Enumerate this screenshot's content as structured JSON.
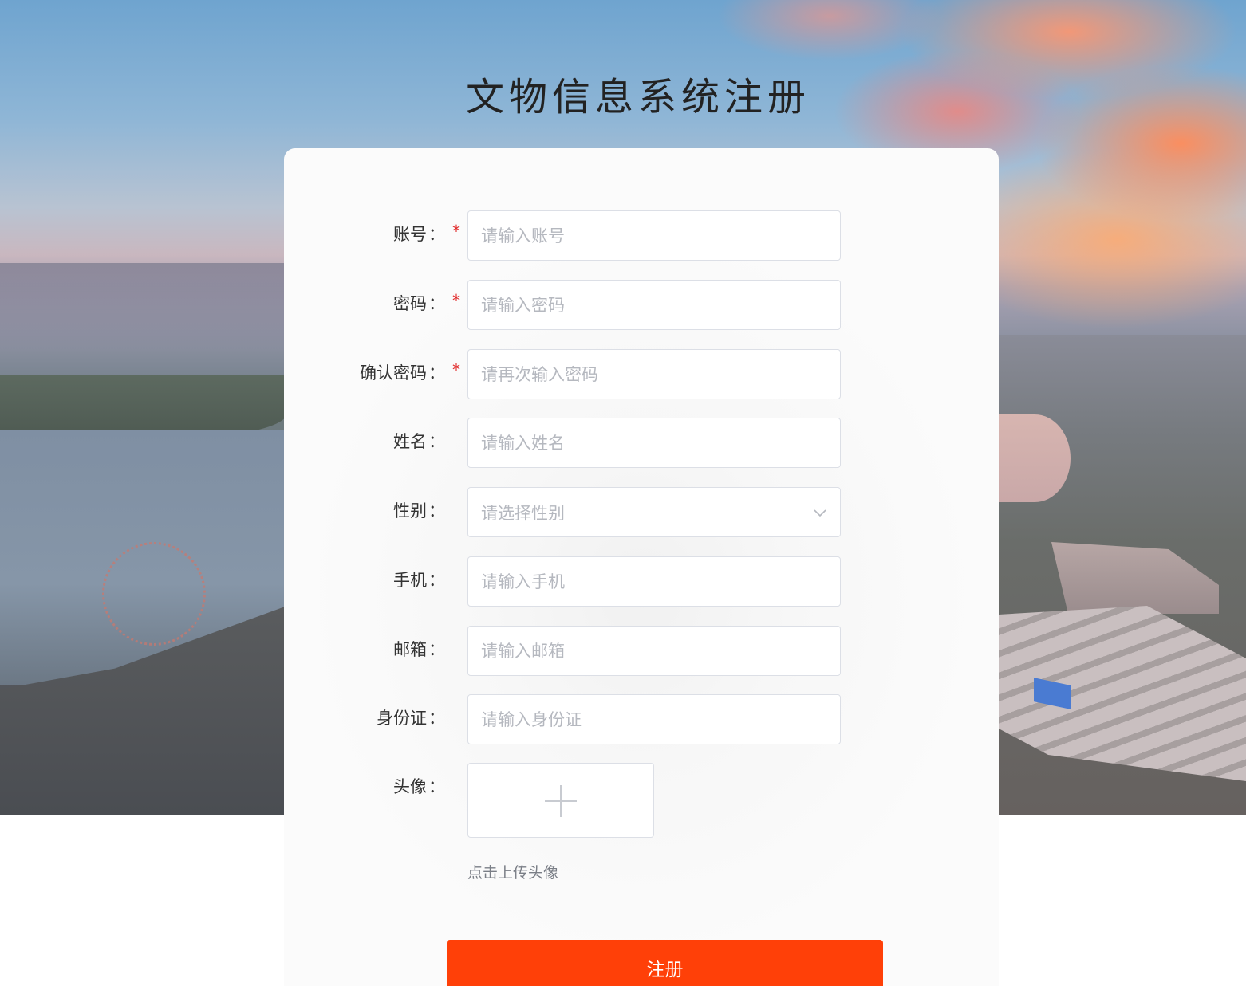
{
  "title": "文物信息系统注册",
  "form": {
    "account": {
      "label": "账号",
      "placeholder": "请输入账号",
      "required": true
    },
    "password": {
      "label": "密码",
      "placeholder": "请输入密码",
      "required": true
    },
    "confirm_password": {
      "label": "确认密码",
      "placeholder": "请再次输入密码",
      "required": true
    },
    "name": {
      "label": "姓名",
      "placeholder": "请输入姓名",
      "required": false
    },
    "gender": {
      "label": "性别",
      "placeholder": "请选择性别",
      "required": false
    },
    "phone": {
      "label": "手机",
      "placeholder": "请输入手机",
      "required": false
    },
    "email": {
      "label": "邮箱",
      "placeholder": "请输入邮箱",
      "required": false
    },
    "id_card": {
      "label": "身份证",
      "placeholder": "请输入身份证",
      "required": false
    },
    "avatar": {
      "label": "头像",
      "hint": "点击上传头像"
    }
  },
  "colon": "：",
  "required_mark": "*",
  "submit_label": "注册",
  "colors": {
    "primary": "#ff4008",
    "required": "#e12b2b",
    "placeholder": "#b5b8bf",
    "border": "#dcdfe6"
  },
  "icons": {
    "select_arrow": "chevron-down-icon",
    "upload": "plus-icon"
  }
}
